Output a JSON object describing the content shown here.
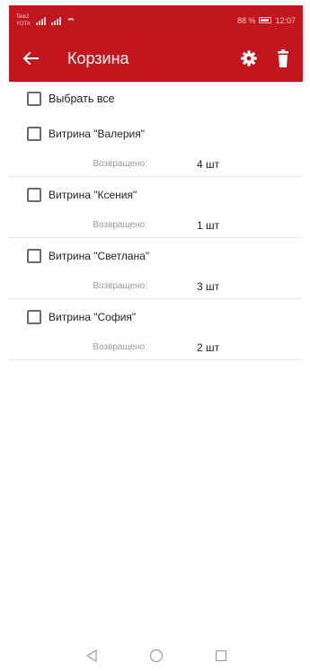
{
  "status_bar": {
    "carrier_1": "Tele2",
    "carrier_2": "YOTA",
    "battery": "88 %",
    "time": "12:07"
  },
  "app_bar": {
    "title": "Корзина",
    "accent_color": "#c3151d"
  },
  "select_all_label": "Выбрать все",
  "items": [
    {
      "name": "Витрина \"Валерия\"",
      "returned_label": "Возвращено:",
      "quantity": "4 шт"
    },
    {
      "name": "Витрина \"Ксения\"",
      "returned_label": "Возвращено:",
      "quantity": "1 шт"
    },
    {
      "name": "Витрина \"Светлана\"",
      "returned_label": "Возвращено:",
      "quantity": "3 шт"
    },
    {
      "name": "Витрина \"София\"",
      "returned_label": "Возвращено:",
      "quantity": "2 шт"
    }
  ],
  "icons": {
    "back": "arrow-left",
    "settings": "gear",
    "delete": "trash",
    "nav_back": "triangle-left",
    "nav_home": "circle",
    "nav_recents": "square"
  }
}
